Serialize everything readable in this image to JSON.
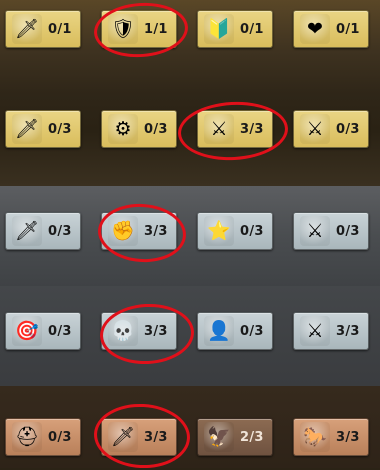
{
  "rows": [
    {
      "tier": "gold",
      "tiles": [
        {
          "icon": "saber-icon",
          "glyph": "🗡",
          "count": "0/1"
        },
        {
          "icon": "armored-knight-target-icon",
          "glyph": "🛡",
          "count": "1/1"
        },
        {
          "icon": "shield-plus-icon",
          "glyph": "🔰",
          "count": "0/1"
        },
        {
          "icon": "winged-heart-icon",
          "glyph": "❤",
          "count": "0/1"
        }
      ]
    },
    {
      "tier": "gold",
      "tiles": [
        {
          "icon": "feathered-sword-icon",
          "glyph": "🗡",
          "count": "0/3"
        },
        {
          "icon": "gear-hammer-icon",
          "glyph": "⚙",
          "count": "0/3"
        },
        {
          "icon": "crossed-swords-group-icon",
          "glyph": "⚔",
          "count": "3/3"
        },
        {
          "icon": "crossed-swords-clock-icon",
          "glyph": "⚔",
          "count": "0/3"
        }
      ]
    },
    {
      "tier": "silver",
      "tiles": [
        {
          "icon": "spear-tip-icon",
          "glyph": "🗡",
          "count": "0/3"
        },
        {
          "icon": "fist-strike-icon",
          "glyph": "✊",
          "count": "3/3"
        },
        {
          "icon": "star-plus-icon",
          "glyph": "⭐",
          "count": "0/3"
        },
        {
          "icon": "crossed-swords-gear-icon",
          "glyph": "⚔",
          "count": "0/3"
        }
      ]
    },
    {
      "tier": "silver",
      "tiles": [
        {
          "icon": "arrow-target-icon",
          "glyph": "🎯",
          "count": "0/3"
        },
        {
          "icon": "skull-heart-icon",
          "glyph": "💀",
          "count": "3/3"
        },
        {
          "icon": "hooded-figure-plus-icon",
          "glyph": "👤",
          "count": "0/3"
        },
        {
          "icon": "crossed-swords-drop-icon",
          "glyph": "⚔",
          "count": "3/3"
        }
      ]
    },
    {
      "tier": "bronze",
      "tiles": [
        {
          "icon": "soldier-helmet-icon",
          "glyph": "⛑",
          "count": "0/3"
        },
        {
          "icon": "sword-heart-icon",
          "glyph": "🗡",
          "count": "3/3"
        },
        {
          "icon": "winged-claw-icon",
          "glyph": "🦅",
          "count": "2/3"
        },
        {
          "icon": "rearing-horse-icon",
          "glyph": "🐎",
          "count": "3/3"
        }
      ]
    }
  ],
  "highlight_color": "#e0101a"
}
